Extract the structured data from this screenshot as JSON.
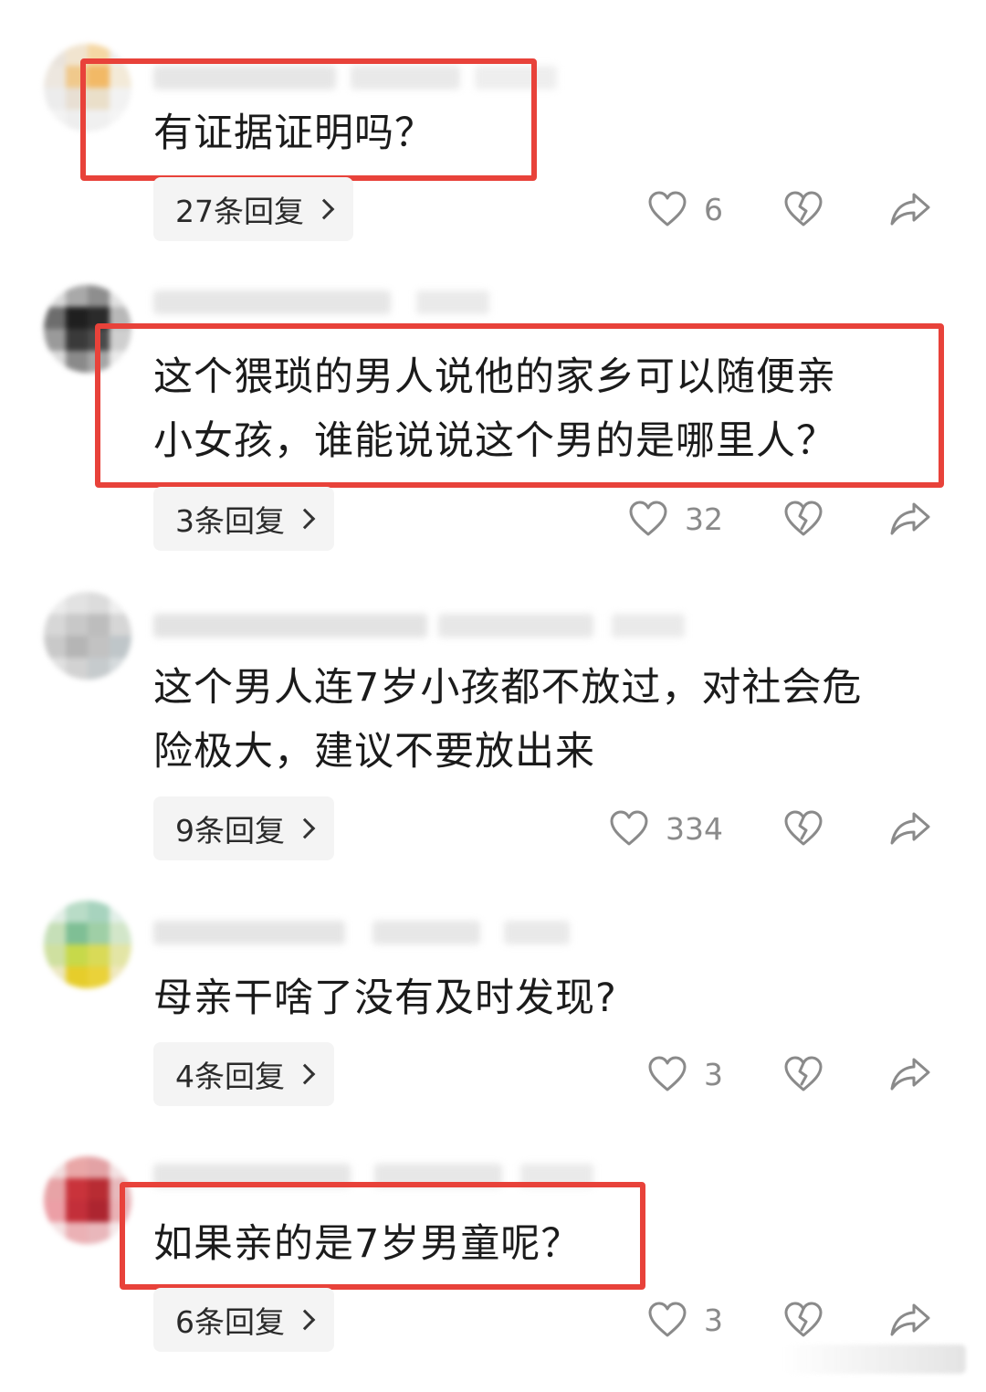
{
  "comments": [
    {
      "text": "有证据证明吗？",
      "replies_label": "27条回复",
      "likes": "6",
      "highlighted": true
    },
    {
      "text": "这个猥琐的男人说他的家乡可以随便亲\n小女孩，谁能说说这个男的是哪里人？",
      "replies_label": "3条回复",
      "likes": "32",
      "highlighted": true
    },
    {
      "text": "这个男人连7岁小孩都不放过，对社会危\n险极大，建议不要放出来",
      "replies_label": "9条回复",
      "likes": "334",
      "highlighted": false
    },
    {
      "text": "母亲干啥了没有及时发现?",
      "replies_label": "4条回复",
      "likes": "3",
      "highlighted": false
    },
    {
      "text": "如果亲的是7岁男童呢？",
      "replies_label": "6条回复",
      "likes": "3",
      "highlighted": true
    }
  ],
  "icons": {
    "like": "heart-outline-icon",
    "dislike": "broken-heart-icon",
    "share": "share-arrow-icon",
    "reply_more": "chevron-right-icon"
  },
  "colors": {
    "highlight": "#e8423a",
    "reply_button_bg": "#f4f4f4",
    "icon": "#8a8a8a",
    "text": "#1b1b1b"
  }
}
